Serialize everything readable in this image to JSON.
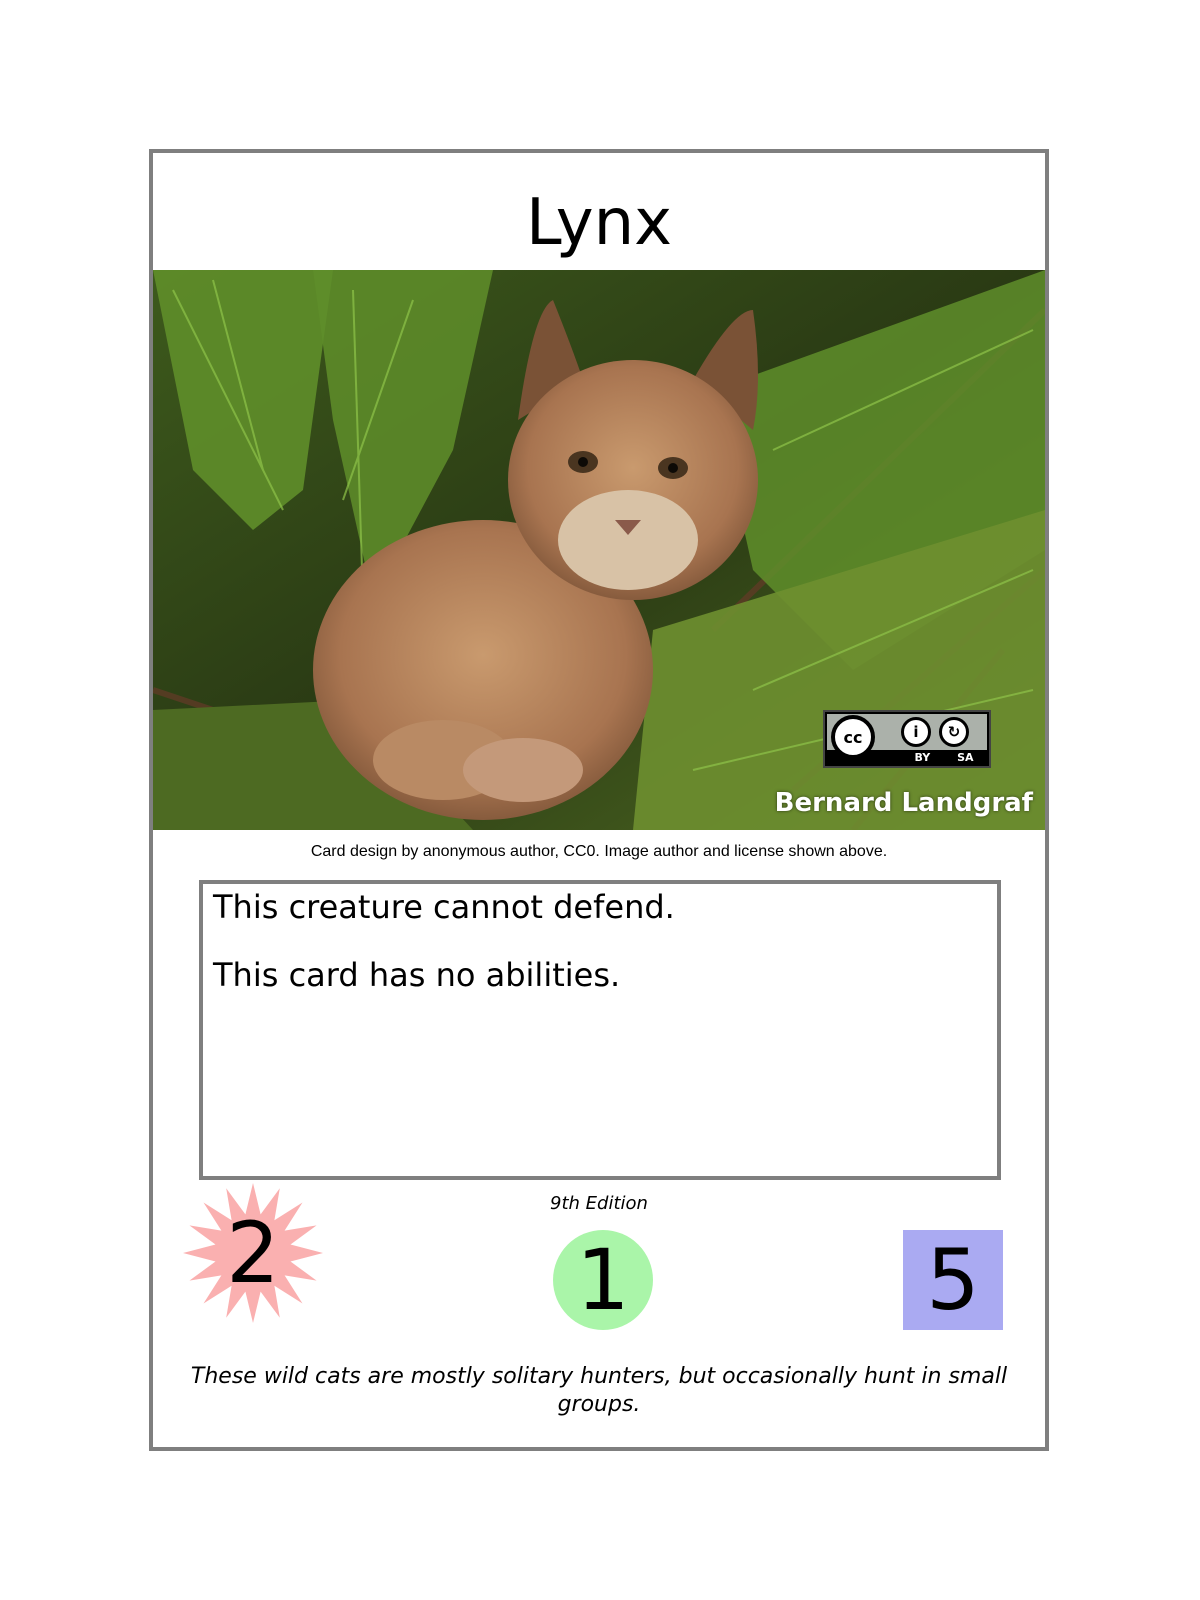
{
  "card": {
    "title": "Lynx",
    "image_credit": "Bernard Landgraf",
    "license": {
      "cc_label": "cc",
      "by_label": "BY",
      "sa_label": "SA"
    },
    "design_credit": "Card design by anonymous author, CC0. Image author and license shown above.",
    "rules_text": [
      "This creature cannot defend.",
      "This card has no abilities."
    ],
    "edition": "9th Edition",
    "stats": {
      "attack": "2",
      "defense": "1",
      "cost": "5"
    },
    "flavor_text": "These wild cats are mostly solitary hunters, but occasionally hunt in small groups.",
    "colors": {
      "attack": "#fab0b0",
      "defense": "#aaf5a9",
      "cost": "#aaaaf2",
      "border": "#7f7f7f"
    }
  }
}
